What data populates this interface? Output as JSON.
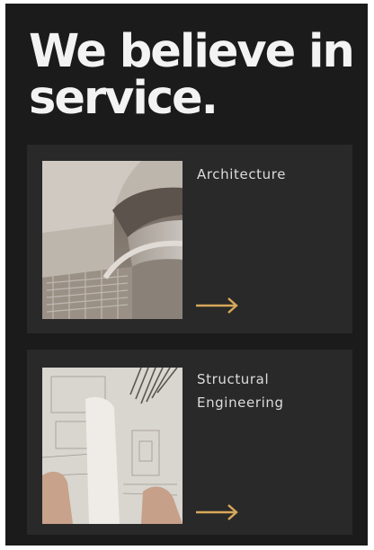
{
  "headline": {
    "line1": "We believe in",
    "line2": "service."
  },
  "services": [
    {
      "title_line1": "Architecture",
      "title_line2": "",
      "icon": "arrow-right-icon"
    },
    {
      "title_line1": "Structural",
      "title_line2": "Engineering",
      "icon": "arrow-right-icon"
    }
  ],
  "colors": {
    "background": "#1b1b1b",
    "card": "#292929",
    "headline": "#f3f3f3",
    "card_text": "#dcdcdc",
    "accent": "#d8a85a"
  }
}
